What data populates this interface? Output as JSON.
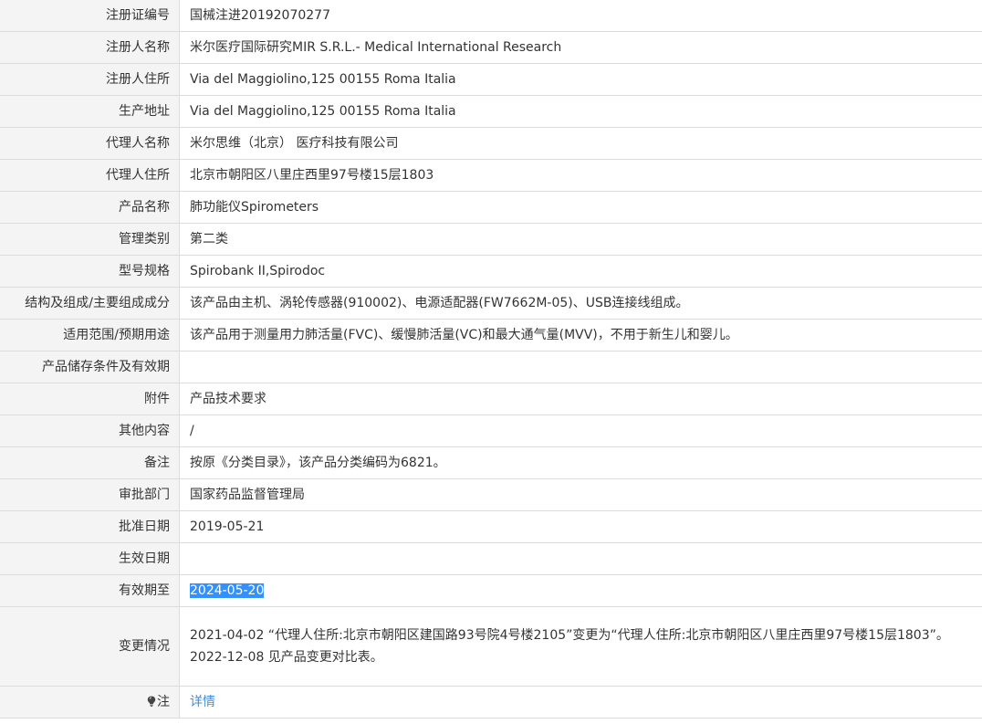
{
  "rows": [
    {
      "label": "注册证编号",
      "value": "国械注进20192070277"
    },
    {
      "label": "注册人名称",
      "value": "米尔医疗国际研究MIR S.R.L.- Medical International Research"
    },
    {
      "label": "注册人住所",
      "value": "Via del Maggiolino,125 00155 Roma Italia"
    },
    {
      "label": "生产地址",
      "value": "Via del Maggiolino,125 00155 Roma Italia"
    },
    {
      "label": "代理人名称",
      "value": "米尔思维（北京） 医疗科技有限公司"
    },
    {
      "label": "代理人住所",
      "value": "北京市朝阳区八里庄西里97号楼15层1803"
    },
    {
      "label": "产品名称",
      "value": "肺功能仪Spirometers"
    },
    {
      "label": "管理类别",
      "value": "第二类"
    },
    {
      "label": "型号规格",
      "value": "Spirobank II,Spirodoc"
    },
    {
      "label": "结构及组成/主要组成成分",
      "value": "该产品由主机、涡轮传感器(910002)、电源适配器(FW7662M-05)、USB连接线组成。"
    },
    {
      "label": "适用范围/预期用途",
      "value": "该产品用于测量用力肺活量(FVC)、缓慢肺活量(VC)和最大通气量(MVV)，不用于新生儿和婴儿。"
    },
    {
      "label": "产品储存条件及有效期",
      "value": ""
    },
    {
      "label": "附件",
      "value": "产品技术要求"
    },
    {
      "label": "其他内容",
      "value": "/"
    },
    {
      "label": "备注",
      "value": "按原《分类目录》，该产品分类编码为6821。"
    },
    {
      "label": "审批部门",
      "value": "国家药品监督管理局"
    },
    {
      "label": "批准日期",
      "value": "2019-05-21"
    },
    {
      "label": "生效日期",
      "value": ""
    },
    {
      "label": "有效期至",
      "value": "2024-05-20"
    }
  ],
  "changes": {
    "label": "变更情况",
    "line1": "2021-04-02 “代理人住所:北京市朝阳区建国路93号院4号楼2105”变更为“代理人住所:北京市朝阳区八里庄西里97号楼15层1803”。",
    "line2": "2022-12-08 见产品变更对比表。"
  },
  "note": {
    "label": "注",
    "icon": "lightbulb-icon",
    "link_text": "详情",
    "link_color": "#3a8ee6"
  },
  "selection_color": "#3390ff"
}
